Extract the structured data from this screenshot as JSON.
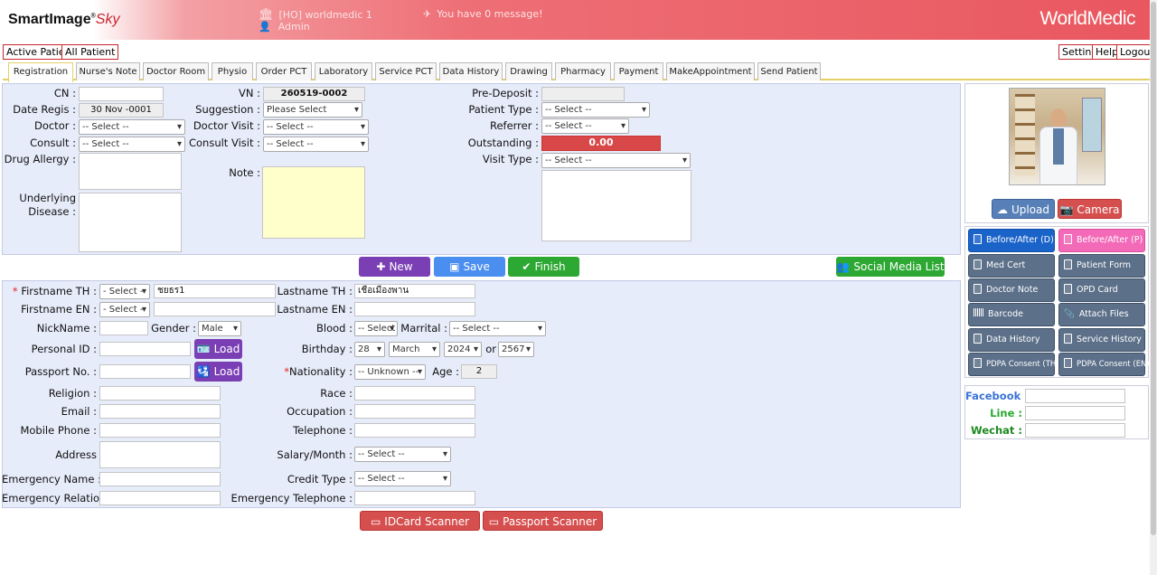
{
  "header": {
    "logo_main": "SmartImage",
    "logo_sky": "Sky",
    "branch": "[HO] worldmedic 1",
    "user": "Admin",
    "message": "You have 0 message!",
    "brand": "WorldMedic"
  },
  "topnav": {
    "active_patient": "Active Patient",
    "all_patient": "All Patient",
    "setting": "Setting",
    "help": "Help",
    "logout": "Logout"
  },
  "tabs": [
    "Registration",
    "Nurse's Note",
    "Doctor Room",
    "Physio",
    "Order PCT",
    "Laboratory",
    "Service PCT",
    "Data History",
    "Drawing",
    "Pharmacy",
    "Payment",
    "MakeAppointment",
    "Send Patient"
  ],
  "visit": {
    "cn_label": "CN :",
    "cn_value": "",
    "date_regis_label": "Date Regis :",
    "date_regis_value": "30 Nov -0001",
    "doctor_label": "Doctor :",
    "doctor_value": "-- Select --",
    "consult_label": "Consult :",
    "consult_value": "-- Select --",
    "drug_allergy_label": "Drug Allergy :",
    "underlying_label_1": "Underlying",
    "underlying_label_2": "Disease :",
    "vn_label": "VN :",
    "vn_value": "260519-0002",
    "suggestion_label": "Suggestion :",
    "suggestion_value": "Please Select",
    "doctor_visit_label": "Doctor Visit :",
    "doctor_visit_value": "-- Select --",
    "consult_visit_label": "Consult Visit :",
    "consult_visit_value": "-- Select --",
    "note_label": "Note :",
    "pre_deposit_label": "Pre-Deposit :",
    "pre_deposit_value": "",
    "patient_type_label": "Patient Type :",
    "patient_type_value": "-- Select --",
    "referrer_label": "Referrer :",
    "referrer_value": "-- Select --",
    "outstanding_label": "Outstanding :",
    "outstanding_value": "0.00",
    "visit_type_label": "Visit Type :",
    "visit_type_value": "-- Select --"
  },
  "actions": {
    "new": "New",
    "save": "Save",
    "finish": "Finish",
    "social": "Social Media List"
  },
  "patient": {
    "firstname_th_label": "Firstname TH :",
    "firstname_th_prefix": "- Select -",
    "firstname_th_value": "ชยธร1",
    "lastname_th_label": "Lastname TH :",
    "lastname_th_value": "เชื่อเมืองพาน",
    "firstname_en_label": "Firstname EN :",
    "firstname_en_prefix": "- Select -",
    "firstname_en_value": "",
    "lastname_en_label": "Lastname EN :",
    "lastname_en_value": "",
    "nickname_label": "NickName :",
    "gender_label": "Gender :",
    "gender_value": "Male",
    "blood_label": "Blood :",
    "blood_value": "-- Select --",
    "marital_label": "Marrital :",
    "marital_value": "-- Select --",
    "personal_id_label": "Personal ID :",
    "load": "Load",
    "birthday_label": "Birthday :",
    "birth_day": "28",
    "birth_month": "March",
    "birth_year": "2024",
    "or_label": "or",
    "birth_year_th": "2567",
    "passport_label": "Passport No. :",
    "nationality_label": "Nationality :",
    "nationality_value": "-- Unknown --",
    "age_label": "Age :",
    "age_value": "2",
    "religion_label": "Religion :",
    "race_label": "Race :",
    "email_label": "Email :",
    "occupation_label": "Occupation :",
    "mobile_label": "Mobile Phone :",
    "telephone_label": "Telephone :",
    "address_label": "Address",
    "salary_label": "Salary/Month :",
    "salary_value": "-- Select --",
    "emergency_name_label": "Emergency Name :",
    "credit_type_label": "Credit Type :",
    "credit_type_value": "-- Select --",
    "emergency_relation_label": "Emergency Relation :",
    "emergency_tel_label": "Emergency Telephone :"
  },
  "scanners": {
    "idcard": "IDCard Scanner",
    "passport": "Passport Scanner"
  },
  "photo": {
    "upload": "Upload",
    "camera": "Camera"
  },
  "side_buttons": {
    "before_after_d": "Before/After (D)",
    "before_after_p": "Before/After (P)",
    "med_cert": "Med Cert",
    "patient_form": "Patient Form",
    "doctor_note": "Doctor Note",
    "opd_card": "OPD Card",
    "barcode": "Barcode",
    "attach_files": "Attach Files",
    "data_history": "Data History",
    "service_history": "Service History",
    "pdpa_th": "PDPA Consent (TH)",
    "pdpa_en": "PDPA Consent (EN)"
  },
  "social": {
    "facebook_label": "Facebook :",
    "line_label": "Line :",
    "wechat_label": "Wechat :"
  },
  "colors": {
    "header_red": "#e9575f",
    "panel_bg": "#e7ecfa",
    "purple": "#7b3fb5",
    "blue": "#4a8ef0",
    "green": "#2da833",
    "scanner_red": "#d64f4f",
    "side_btn": "#5c7089",
    "outstanding": "#d94848"
  }
}
